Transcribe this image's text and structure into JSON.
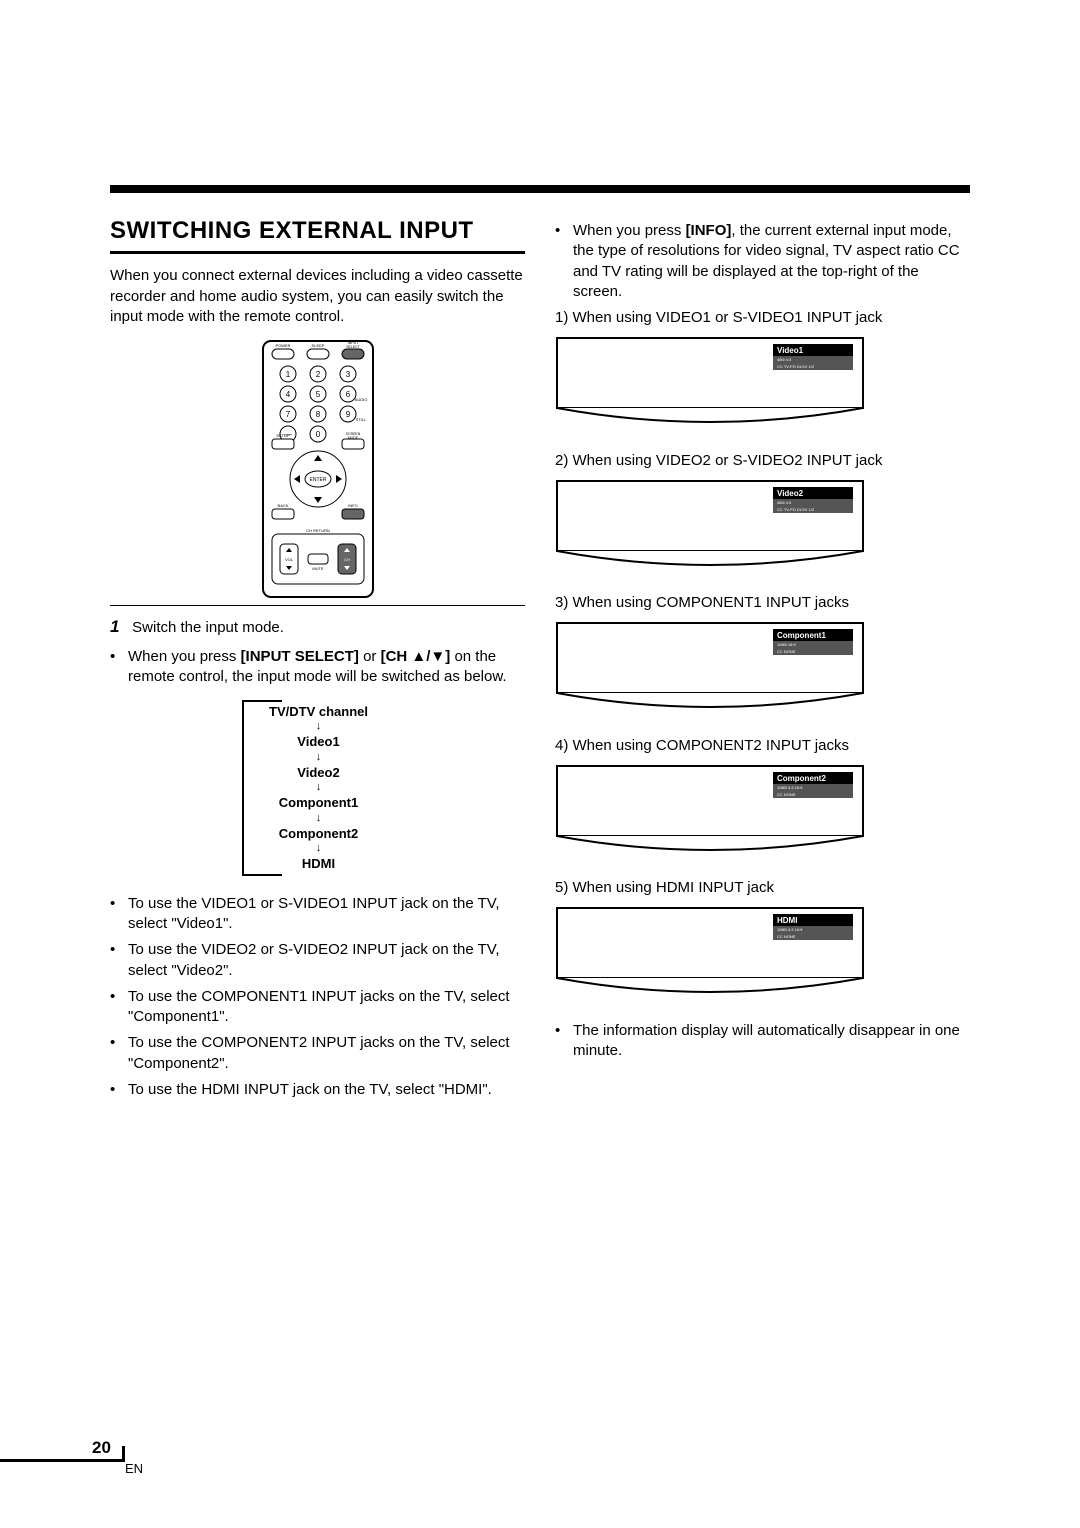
{
  "page": {
    "number": "20",
    "lang": "EN"
  },
  "section": {
    "title": "SWITCHING EXTERNAL INPUT",
    "intro": "When you connect external devices including a video cassette recorder and home audio system, you can easily switch the input mode with the remote control."
  },
  "remote": {
    "top_labels": {
      "power": "POWER",
      "sleep": "SLEEP",
      "input_select": "INPUT\nSELECT"
    },
    "keypad": [
      "1",
      "2",
      "3",
      "4",
      "5",
      "6",
      "7",
      "8",
      "9",
      "—",
      "0"
    ],
    "side_labels": {
      "audio": "AUDIO",
      "still": "STILL"
    },
    "row_labels": {
      "setup": "SETUP",
      "screen_mode": "SCREEN\nMODE"
    },
    "center": "ENTER",
    "bottom_labels": {
      "back": "BACK",
      "info": "INFO",
      "ch_return": "CH RETURN",
      "vol": "VOL",
      "mute": "MUTE",
      "ch": "CH"
    }
  },
  "step1": {
    "number": "1",
    "text": "Switch the input mode.",
    "bullet1_a": "When you press ",
    "bullet1_b_bold": "[INPUT SELECT]",
    "bullet1_c": " or ",
    "bullet1_d_bold": "[CH ",
    "bullet1_e_arrows": "▲/▼]",
    "bullet1_f": " on the remote control, the input mode will be switched as below."
  },
  "cycle": {
    "items": [
      "TV/DTV channel",
      "Video1",
      "Video2",
      "Component1",
      "Component2",
      "HDMI"
    ]
  },
  "inputUseBullets": [
    "To use the VIDEO1 or S-VIDEO1 INPUT jack on the TV, select \"Video1\".",
    "To use the VIDEO2 or S-VIDEO2 INPUT jack on the TV, select \"Video2\".",
    "To use the COMPONENT1 INPUT jacks on the TV, select \"Component1\".",
    "To use the COMPONENT2 INPUT jacks on the TV, select \"Component2\".",
    "To use the HDMI INPUT jack on the TV, select \"HDMI\"."
  ],
  "right": {
    "infoBullet_a": "When you press ",
    "infoBullet_b_bold": "[INFO]",
    "infoBullet_c": ", the current external input mode, the type of resolutions for video signal, TV aspect ratio CC and TV rating will be displayed at the top-right of the screen.",
    "examples": [
      {
        "caption": "1) When using VIDEO1 or S-VIDEO1 INPUT jack",
        "osd_title": "Video1",
        "osd_line1": "480i  4:3",
        "osd_line2": "CC TV-PG DLSV  1/2"
      },
      {
        "caption": "2) When using VIDEO2 or S-VIDEO2 INPUT jack",
        "osd_title": "Video2",
        "osd_line1": "480i  4:3",
        "osd_line2": "CC TV-PG DLSV  1/2"
      },
      {
        "caption": "3) When using COMPONENT1 INPUT jacks",
        "osd_title": "Component1",
        "osd_line1": "1080i  16:9",
        "osd_line2": "CC NONE"
      },
      {
        "caption": "4) When using COMPONENT2 INPUT jacks",
        "osd_title": "Component2",
        "osd_line1": "1080i  4:3  16:9",
        "osd_line2": "CC NONE"
      },
      {
        "caption": "5) When using HDMI INPUT jack",
        "osd_title": "HDMI",
        "osd_line1": "1080i  4:3  16:9",
        "osd_line2": "CC NONE"
      }
    ],
    "trailingBullet": "The information display will automatically disappear in one minute."
  }
}
